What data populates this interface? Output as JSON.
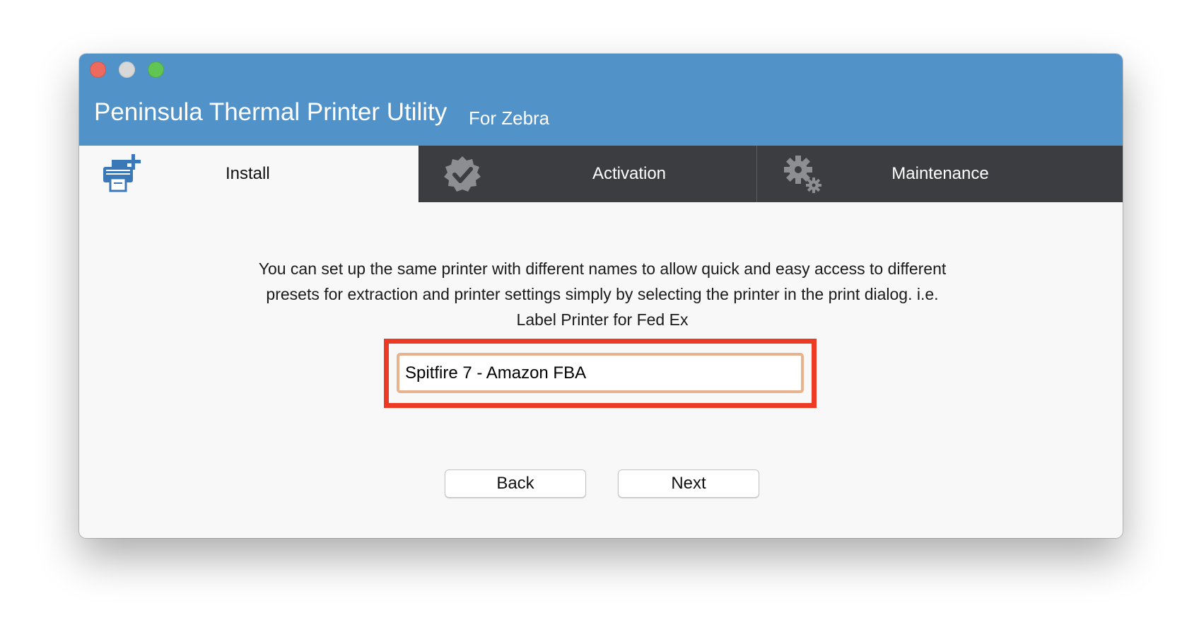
{
  "window": {
    "title": "Peninsula Thermal Printer Utility",
    "subtitle": "For Zebra",
    "titlebar_color": "#5192c9"
  },
  "tabs": [
    {
      "label": "Install",
      "icon": "printer-add-icon",
      "active": true
    },
    {
      "label": "Activation",
      "icon": "verified-badge-icon",
      "active": false
    },
    {
      "label": "Maintenance",
      "icon": "gears-icon",
      "active": false
    }
  ],
  "install": {
    "description": "You can set up the same printer with different names to allow quick and easy access to different presets for extraction and printer settings simply by selecting the printer in the print dialog. i.e. Label Printer for Fed Ex",
    "printer_name_value": "Spitfire 7 - Amazon FBA",
    "highlight_color": "#ec3a24"
  },
  "buttons": {
    "back": "Back",
    "next": "Next"
  }
}
